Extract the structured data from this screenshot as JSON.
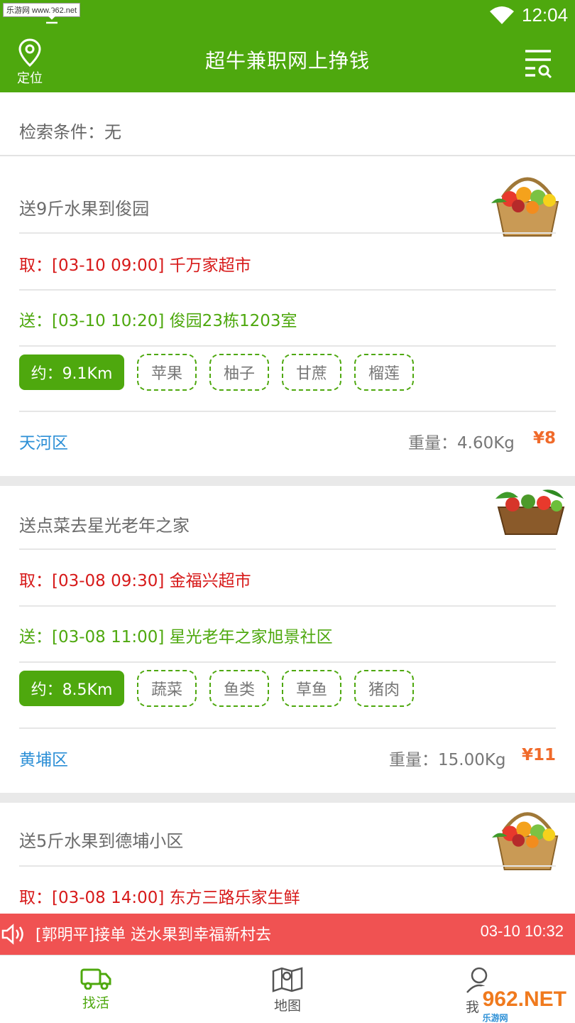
{
  "status_bar": {
    "watermark": "乐游网 www.962.net",
    "time": "12:04"
  },
  "header": {
    "location_label": "定位",
    "title": "超牛兼职网上挣钱"
  },
  "search": {
    "condition": "检索条件：无"
  },
  "orders": [
    {
      "title": "送9斤水果到俊园",
      "pickup": "取：[03-10 09:00] 千万家超市",
      "dropoff": "送：[03-10 10:20] 俊园23栋1203室",
      "distance": "约：9.1Km",
      "tags": [
        "苹果",
        "柚子",
        "甘蔗",
        "榴莲"
      ],
      "district": "天河区",
      "weight": "重量：4.60Kg",
      "price": "¥8",
      "thumb": "fruit-basket"
    },
    {
      "title": "送点菜去星光老年之家",
      "pickup": "取：[03-08 09:30] 金福兴超市",
      "dropoff": "送：[03-08 11:00] 星光老年之家旭景社区",
      "distance": "约：8.5Km",
      "tags": [
        "蔬菜",
        "鱼类",
        "草鱼",
        "猪肉"
      ],
      "district": "黄埔区",
      "weight": "重量：15.00Kg",
      "price": "¥11",
      "thumb": "vegetable-basket"
    },
    {
      "title": "送5斤水果到德埔小区",
      "pickup": "取：[03-08 14:00] 东方三路乐家生鲜",
      "thumb": "fruit-basket"
    }
  ],
  "notice": {
    "message": "[郭明平]接单 送水果到幸福新村去",
    "time": "03-10 10:32"
  },
  "tabs": [
    {
      "label": "找活",
      "icon": "truck-icon"
    },
    {
      "label": "地图",
      "icon": "map-icon"
    },
    {
      "label": "我的",
      "icon": "user-icon"
    }
  ],
  "logo": {
    "text": "962.NET",
    "sub": "乐游网"
  },
  "colors": {
    "brand_green": "#4ea80e",
    "pickup_red": "#d71a1a",
    "district_blue": "#2c8fd6",
    "price_orange": "#f06a2a",
    "notice_red": "#f05252"
  }
}
